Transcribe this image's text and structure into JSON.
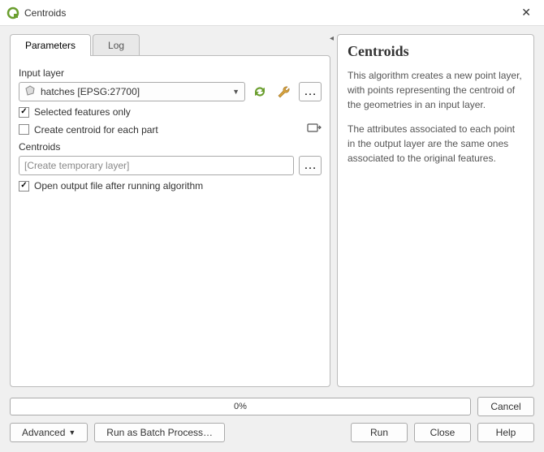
{
  "window": {
    "title": "Centroids",
    "close": "✕"
  },
  "tabs": {
    "parameters": "Parameters",
    "log": "Log"
  },
  "params": {
    "input_layer_label": "Input layer",
    "input_layer_value": "hatches [EPSG:27700]",
    "selected_only_label": "Selected features only",
    "selected_only_checked": true,
    "each_part_label": "Create centroid for each part",
    "each_part_checked": false,
    "output_label": "Centroids",
    "output_placeholder": "[Create temporary layer]",
    "open_after_label": "Open output file after running algorithm",
    "open_after_checked": true,
    "browse_dots": "…"
  },
  "help": {
    "title": "Centroids",
    "p1": "This algorithm creates a new point layer, with points representing the centroid of the geometries in an input layer.",
    "p2": "The attributes associated to each point in the output layer are the same ones associated to the original features."
  },
  "progress": {
    "text": "0%"
  },
  "buttons": {
    "cancel": "Cancel",
    "advanced": "Advanced",
    "batch": "Run as Batch Process…",
    "run": "Run",
    "close": "Close",
    "help": "Help"
  }
}
